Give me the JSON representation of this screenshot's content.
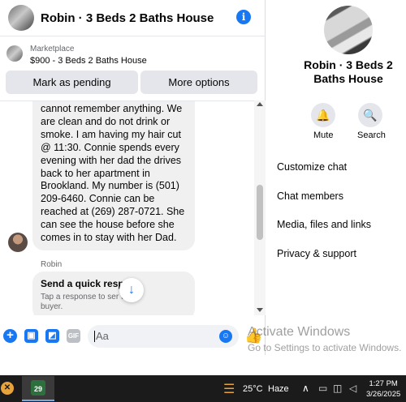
{
  "header": {
    "title": "Robin · 3 Beds 2 Baths House",
    "info_glyph": "i"
  },
  "marketplace": {
    "label": "Marketplace",
    "listing": "$900 - 3 Beds 2 Baths House"
  },
  "buttons": {
    "mark_pending": "Mark as pending",
    "more_options": "More options"
  },
  "messages": {
    "incoming_text": "cannot remember anything.  We\nare clean and do not drink or\nsmoke.  I am having my hair cut\n@ 11:30.  Connie spends every\nevening with her dad the drives\nback to her apartment in\nBrookland.  My number is (501)\n209-6460.   Connie can be\nreached at (269) 287-0721.  She\ncan see the house before she\ncomes in to stay with her Dad.",
    "sender_name": "Robin",
    "quick_response_title": "Send a quick respo",
    "quick_response_sub": "Tap a response to ser      the buyer.",
    "scroll_down_glyph": "↓"
  },
  "composer": {
    "plus_glyph": "+",
    "photo_glyph": "▣",
    "sticker_glyph": "◩",
    "gif_label": "GIF",
    "placeholder": "Aa",
    "emoji_glyph": "☺",
    "like_glyph": "👍"
  },
  "watermark": {
    "line1": "Activate Windows",
    "line2": "Go to Settings to activate Windows."
  },
  "info_panel": {
    "title": "Robin · 3 Beds 2 Baths House",
    "mute_label": "Mute",
    "search_label": "Search",
    "mute_glyph": "🔔",
    "search_glyph": "🔍",
    "menu": [
      "Customize chat",
      "Chat members",
      "Media, files and links",
      "Privacy & support"
    ]
  },
  "taskbar": {
    "calendar_day": "29",
    "temperature": "25°C",
    "weather": "Haze",
    "chevron": "∧",
    "time": "1:27 PM",
    "date": "3/26/2025"
  }
}
